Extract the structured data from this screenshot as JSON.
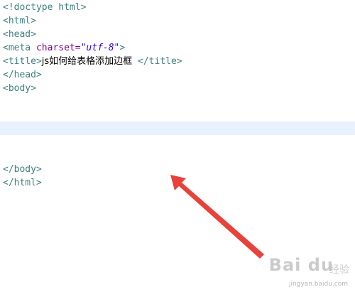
{
  "code": {
    "l1_open": "<!doctype html>",
    "l2": "<html>",
    "l3": "<head>",
    "l4_tag_open": "<meta ",
    "l4_attr": "charset=",
    "l4_val": "\"utf-8\"",
    "l4_close": ">",
    "l5_open": "<title>",
    "l5_text": "js如何给表格添加边框",
    "l5_close": " </title>",
    "l6": "</head>",
    "l7": "<body>",
    "l8": "</body>",
    "l9": "</html>"
  },
  "annotation": {
    "arrow_color": "#e8423a"
  },
  "watermark": {
    "logo": "Bai du",
    "suffix": "经验",
    "url": "jingyan.baidu.com"
  }
}
